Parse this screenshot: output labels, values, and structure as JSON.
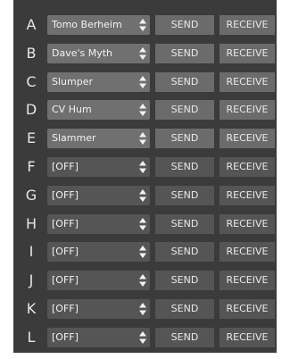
{
  "colors": {
    "panel_background": "#3b3b3b",
    "assigned_control": "#707070",
    "off_control": "#555555",
    "text": "#e6e6e6"
  },
  "icons": {
    "select_arrows": "up-down-arrows-icon"
  },
  "rows": [
    {
      "letter": "A",
      "value": "Tomo Berheim",
      "state": "assigned",
      "send_label": "SEND",
      "receive_label": "RECEIVE"
    },
    {
      "letter": "B",
      "value": "Dave's Myth",
      "state": "assigned",
      "send_label": "SEND",
      "receive_label": "RECEIVE"
    },
    {
      "letter": "C",
      "value": "Slumper",
      "state": "assigned",
      "send_label": "SEND",
      "receive_label": "RECEIVE"
    },
    {
      "letter": "D",
      "value": "CV Hum",
      "state": "assigned",
      "send_label": "SEND",
      "receive_label": "RECEIVE"
    },
    {
      "letter": "E",
      "value": "Slammer",
      "state": "assigned",
      "send_label": "SEND",
      "receive_label": "RECEIVE"
    },
    {
      "letter": "F",
      "value": "[OFF]",
      "state": "off",
      "send_label": "SEND",
      "receive_label": "RECEIVE"
    },
    {
      "letter": "G",
      "value": "[OFF]",
      "state": "off",
      "send_label": "SEND",
      "receive_label": "RECEIVE"
    },
    {
      "letter": "H",
      "value": "[OFF]",
      "state": "off",
      "send_label": "SEND",
      "receive_label": "RECEIVE"
    },
    {
      "letter": "I",
      "value": "[OFF]",
      "state": "off",
      "send_label": "SEND",
      "receive_label": "RECEIVE"
    },
    {
      "letter": "J",
      "value": "[OFF]",
      "state": "off",
      "send_label": "SEND",
      "receive_label": "RECEIVE"
    },
    {
      "letter": "K",
      "value": "[OFF]",
      "state": "off",
      "send_label": "SEND",
      "receive_label": "RECEIVE"
    },
    {
      "letter": "L",
      "value": "[OFF]",
      "state": "off",
      "send_label": "SEND",
      "receive_label": "RECEIVE"
    }
  ]
}
